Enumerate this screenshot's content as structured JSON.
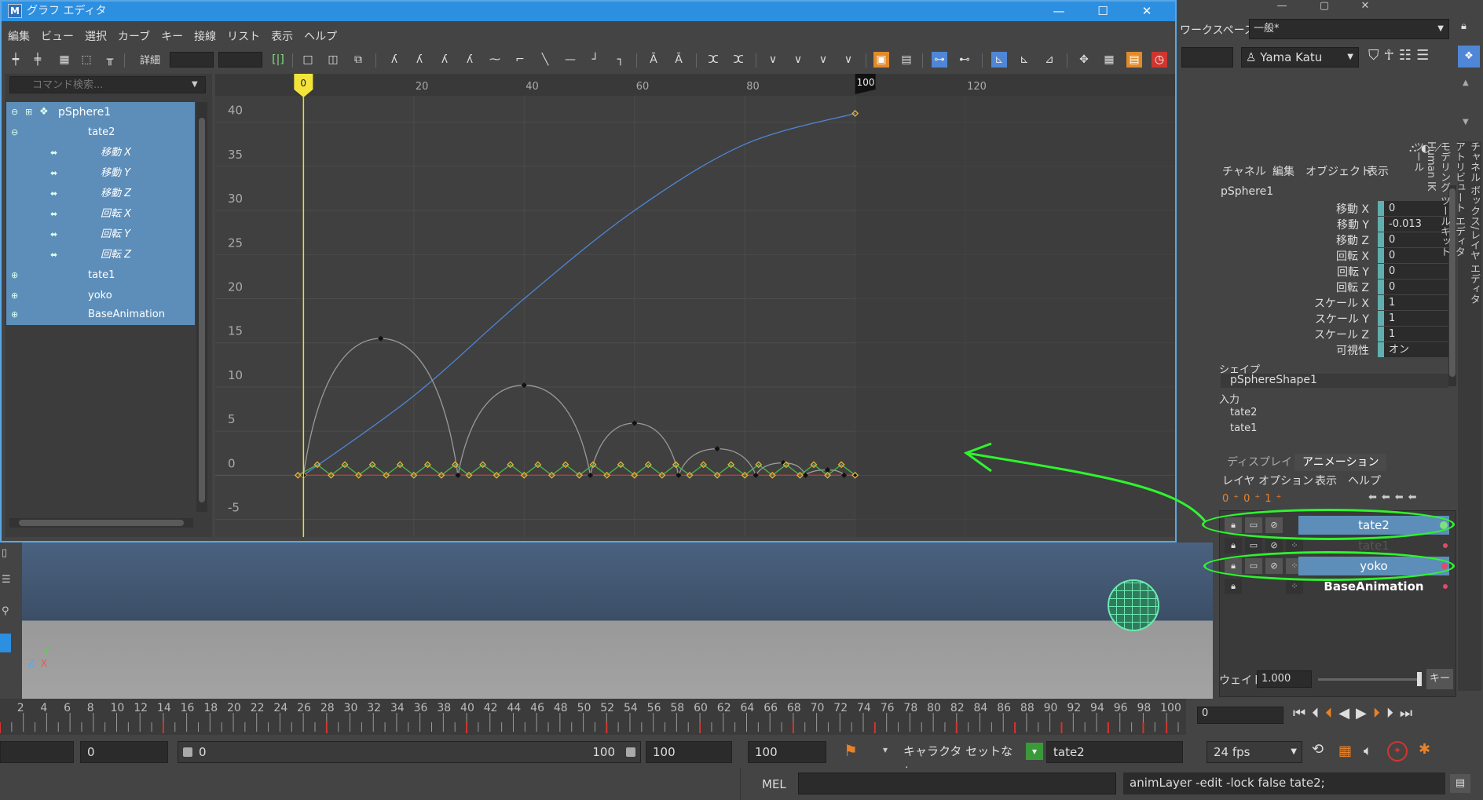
{
  "graph_editor": {
    "title": "グラフ エディタ",
    "logo": "M",
    "window_controls": [
      "minimize-icon",
      "maximize-icon",
      "close-icon"
    ],
    "menu": [
      "編集",
      "ビュー",
      "選択",
      "カーブ",
      "キー",
      "接線",
      "リスト",
      "表示",
      "ヘルプ"
    ],
    "detail_label": "詳細",
    "command_search_placeholder": "コマンド検索...",
    "outliner": [
      {
        "label": "pSphere1",
        "level": 0
      },
      {
        "label": "tate2",
        "level": 1
      },
      {
        "label": "移動 X",
        "level": 2
      },
      {
        "label": "移動 Y",
        "level": 2
      },
      {
        "label": "移動 Z",
        "level": 2
      },
      {
        "label": "回転 X",
        "level": 2
      },
      {
        "label": "回転 Y",
        "level": 2
      },
      {
        "label": "回転 Z",
        "level": 2
      },
      {
        "label": "tate1",
        "level": 1
      },
      {
        "label": "yoko",
        "level": 1
      },
      {
        "label": "BaseAnimation",
        "level": 1
      }
    ],
    "frame_ticks": [
      "20",
      "40",
      "60",
      "80",
      "100",
      "120"
    ],
    "current_frame_marker": "0",
    "end_frame_marker": "100",
    "value_ticks": [
      "40",
      "35",
      "30",
      "25",
      "20",
      "15",
      "10",
      "5",
      "0",
      "-5"
    ]
  },
  "chart_data": {
    "type": "line",
    "xlim": [
      -16,
      158
    ],
    "ylim": [
      -7,
      43
    ],
    "x_ticks": [
      20,
      40,
      60,
      80,
      100,
      120
    ],
    "y_ticks": [
      -5,
      0,
      5,
      10,
      15,
      20,
      25,
      30,
      35,
      40
    ],
    "grid": true,
    "series": [
      {
        "color": "#4f86d6",
        "curve": "smooth",
        "points": [
          [
            0,
            0
          ],
          [
            20,
            9
          ],
          [
            40,
            20
          ],
          [
            60,
            30
          ],
          [
            80,
            37.5
          ],
          [
            100,
            41
          ]
        ]
      },
      {
        "color": "#9a9a9a",
        "curve": "bounce",
        "points": [
          [
            0,
            0
          ],
          [
            14,
            15.5
          ],
          [
            28,
            0
          ],
          [
            40,
            10.2
          ],
          [
            52,
            0
          ],
          [
            60,
            5.9
          ],
          [
            68,
            0
          ],
          [
            75,
            3.0
          ],
          [
            82,
            0
          ],
          [
            87,
            1.4
          ],
          [
            91,
            0
          ],
          [
            95,
            0.6
          ],
          [
            98,
            0
          ],
          [
            100,
            0
          ]
        ]
      },
      {
        "color": "#49b84a",
        "curve": "zigzag",
        "points": [
          [
            -1,
            0
          ],
          [
            2.5,
            1.2
          ],
          [
            5,
            0
          ],
          [
            7.5,
            1.2
          ],
          [
            10,
            0
          ],
          [
            12.5,
            1.2
          ],
          [
            15,
            0
          ],
          [
            17.5,
            1.2
          ],
          [
            20,
            0
          ],
          [
            22.5,
            1.2
          ],
          [
            25,
            0
          ],
          [
            27.5,
            1.2
          ],
          [
            30,
            0
          ],
          [
            32.5,
            1.2
          ],
          [
            35,
            0
          ],
          [
            37.5,
            1.2
          ],
          [
            40,
            0
          ],
          [
            42.5,
            1.2
          ],
          [
            45,
            0
          ],
          [
            47.5,
            1.2
          ],
          [
            50,
            0
          ],
          [
            52.5,
            1.2
          ],
          [
            55,
            0
          ],
          [
            57.5,
            1.2
          ],
          [
            60,
            0
          ],
          [
            62.5,
            1.2
          ],
          [
            65,
            0
          ],
          [
            67.5,
            1.2
          ],
          [
            70,
            0
          ],
          [
            72.5,
            1.2
          ],
          [
            75,
            0
          ],
          [
            77.5,
            1.2
          ],
          [
            80,
            0
          ],
          [
            82.5,
            1.2
          ],
          [
            85,
            0
          ],
          [
            87.5,
            1.2
          ],
          [
            90,
            0
          ],
          [
            92.5,
            1.2
          ],
          [
            95,
            0
          ],
          [
            97.5,
            1.2
          ],
          [
            100,
            0
          ]
        ]
      },
      {
        "color": "#d0362f",
        "curve": "flat",
        "points": [
          [
            -1,
            0
          ],
          [
            100,
            0
          ]
        ]
      }
    ]
  },
  "workspace": {
    "label": "ワークスペース:",
    "value": "一般*"
  },
  "user": "Yama Katu",
  "channel_box": {
    "menu": [
      "チャネル",
      "編集",
      "オブジェクト",
      "表示"
    ],
    "object": "pSphere1",
    "channels": [
      {
        "label": "移動 X",
        "value": "0"
      },
      {
        "label": "移動 Y",
        "value": "-0.013"
      },
      {
        "label": "移動 Z",
        "value": "0"
      },
      {
        "label": "回転 X",
        "value": "0"
      },
      {
        "label": "回転 Y",
        "value": "0"
      },
      {
        "label": "回転 Z",
        "value": "0"
      },
      {
        "label": "スケール X",
        "value": "1"
      },
      {
        "label": "スケール Y",
        "value": "1"
      },
      {
        "label": "スケール Z",
        "value": "1"
      },
      {
        "label": "可視性",
        "value": "オン"
      }
    ],
    "shape_header": "シェイプ",
    "shape": "pSphereShape1",
    "input_header": "入力",
    "inputs": [
      "tate2",
      "tate1"
    ]
  },
  "layer_editor": {
    "tabs": [
      "ディスプレイ",
      "アニメーション"
    ],
    "menu": [
      "レイヤ",
      "オプション",
      "表示",
      "ヘルプ"
    ],
    "layers": [
      {
        "name": "tate2",
        "selected": true,
        "dot": "#7ee07e"
      },
      {
        "name": "tate1",
        "selected": false,
        "dot": "#e04b6b"
      },
      {
        "name": "yoko",
        "selected": true,
        "dot": "#e04b6b"
      },
      {
        "name": "BaseAnimation",
        "selected": false,
        "dot": "#e04b6b"
      }
    ],
    "weight_label": "ウェイト",
    "weight_value": "1.000",
    "key_button": "キー"
  },
  "side_tabs": [
    "チャネル ボックス/レイヤ エディタ",
    "アトリビュート エディタ",
    "モデリング ツールキット",
    "Human IK",
    "ツール"
  ],
  "timeline": {
    "labels": [
      "2",
      "4",
      "6",
      "8",
      "10",
      "12",
      "14",
      "16",
      "18",
      "20",
      "22",
      "24",
      "26",
      "28",
      "30",
      "32",
      "34",
      "36",
      "38",
      "40",
      "42",
      "44",
      "46",
      "48",
      "50",
      "52",
      "54",
      "56",
      "58",
      "60",
      "62",
      "64",
      "66",
      "68",
      "70",
      "72",
      "74",
      "76",
      "78",
      "80",
      "82",
      "84",
      "86",
      "88",
      "90",
      "92",
      "94",
      "96",
      "98",
      "100"
    ],
    "current_frame": "0"
  },
  "range": {
    "start": "0",
    "slider_start": "0",
    "slider_end": "100",
    "end": "100",
    "anim_end": "100",
    "character_set": "キャラクタ セットなし",
    "active_layer": "tate2",
    "fps": "24 fps"
  },
  "command_line": {
    "mel_label": "MEL",
    "output": "animLayer -edit -lock false tate2;"
  }
}
